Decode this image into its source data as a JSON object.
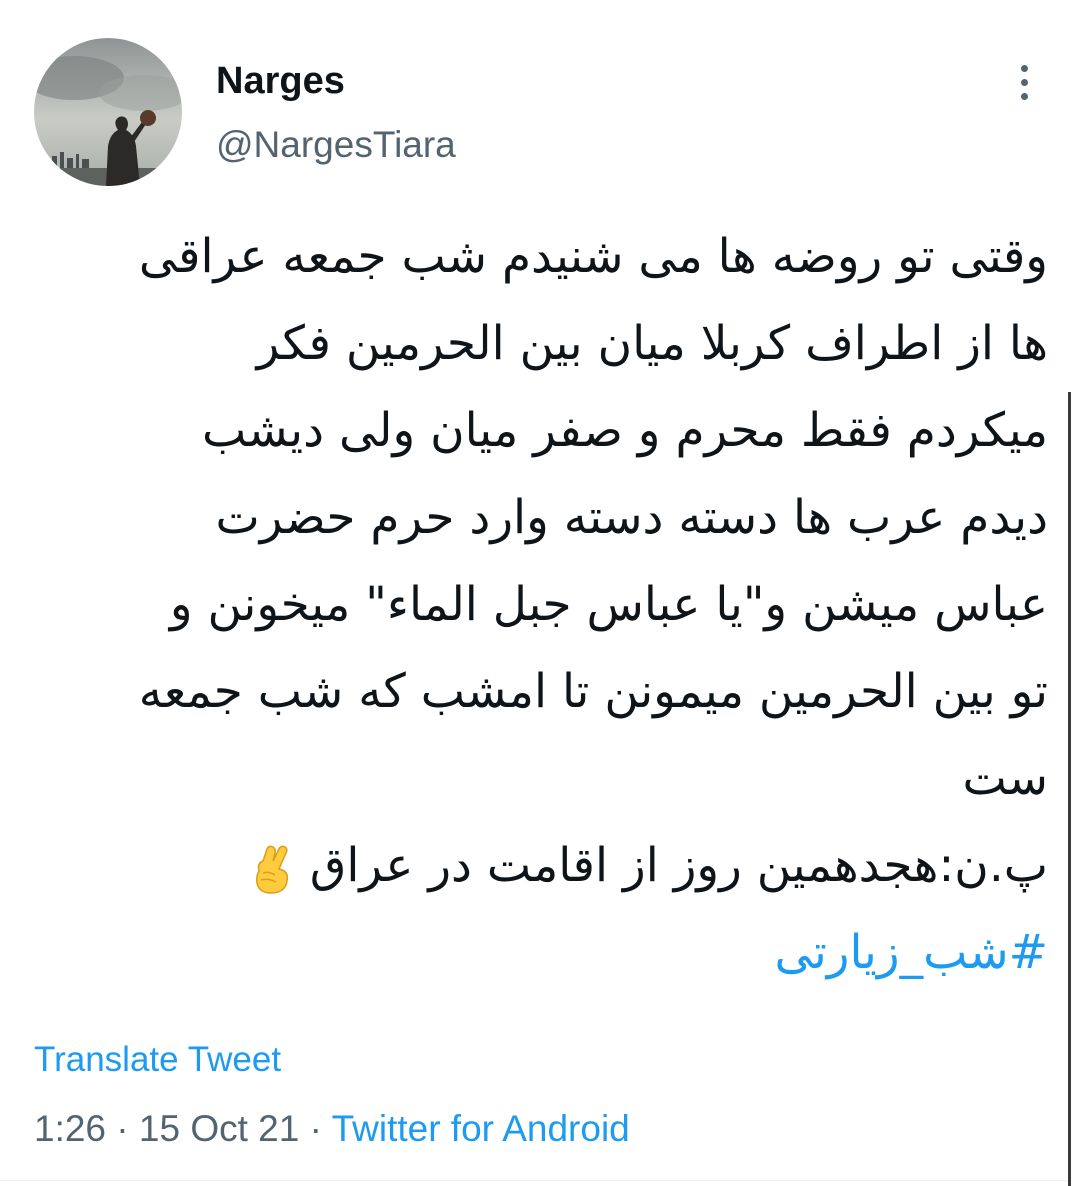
{
  "user": {
    "display_name": "Narges",
    "handle": "@NargesTiara"
  },
  "menu": {
    "icon": "more-vertical-icon"
  },
  "tweet": {
    "lines": [
      "وقتی تو روضه ها می شنیدم شب جمعه عراقی",
      "ها از اطراف کربلا میان بین الحرمین فکر",
      "میکردم  فقط محرم و صفر میان ولی دیشب",
      "دیدم عرب ها دسته دسته وارد حرم حضرت",
      "عباس میشن و\"یا عباس جبل الماء\" میخونن و",
      "تو بین الحرمین میمونن تا امشب که شب جمعه",
      "ست",
      "پ.ن:هجدهمین روز از اقامت در عراق"
    ],
    "emoji": "crossed-fingers-icon",
    "hashtag": "#شب_زیارتی"
  },
  "translate_label": "Translate Tweet",
  "meta": {
    "time": "1:26",
    "separator": " · ",
    "date": "15 Oct 21",
    "source": "Twitter for Android"
  },
  "colors": {
    "text": "#0f1419",
    "secondary": "#536471",
    "link": "#1d9bf0"
  }
}
